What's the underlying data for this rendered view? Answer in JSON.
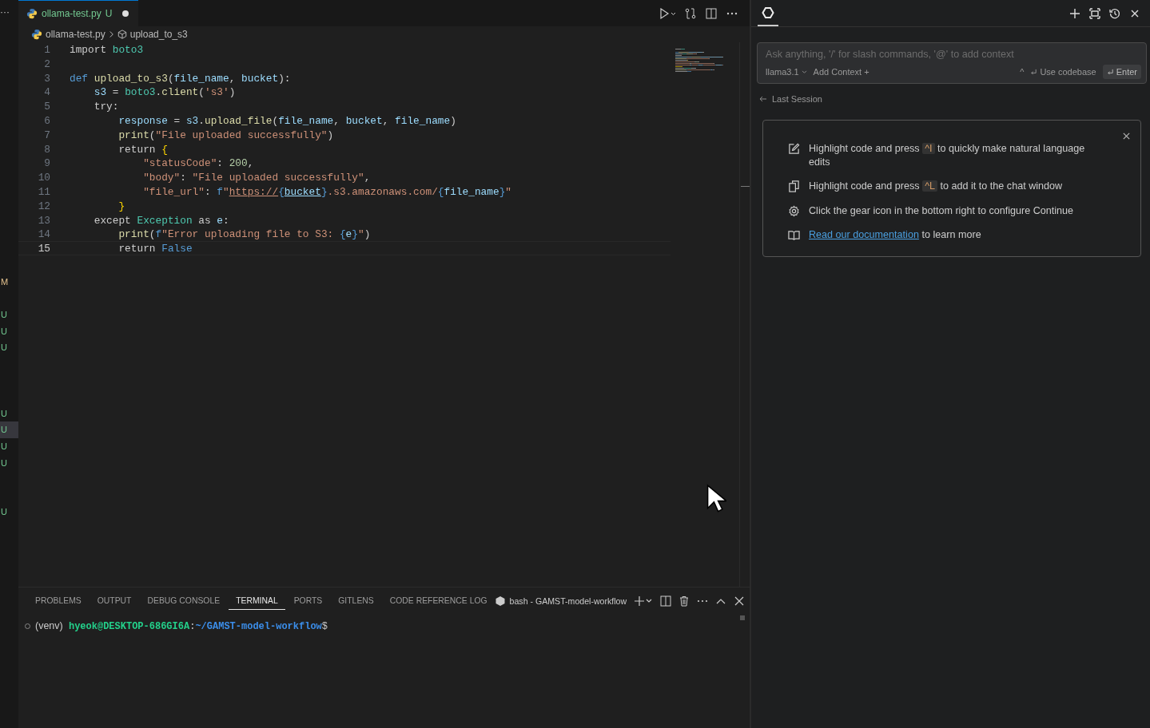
{
  "activity_bar": {
    "overflow": "···",
    "badges": [
      {
        "kind": "badge",
        "letter": "M",
        "color": "#e2c08d",
        "selected": false
      },
      {
        "kind": "spacer"
      },
      {
        "kind": "badge",
        "letter": "U",
        "color": "#73c991",
        "selected": false
      },
      {
        "kind": "badge",
        "letter": "U",
        "color": "#73c991",
        "selected": false
      },
      {
        "kind": "badge",
        "letter": "U",
        "color": "#73c991",
        "selected": false
      },
      {
        "kind": "spacer"
      },
      {
        "kind": "spacer"
      },
      {
        "kind": "spacer"
      },
      {
        "kind": "badge",
        "letter": "U",
        "color": "#73c991",
        "selected": false
      },
      {
        "kind": "badge",
        "letter": "U",
        "color": "#73c991",
        "selected": true
      },
      {
        "kind": "badge",
        "letter": "U",
        "color": "#73c991",
        "selected": false
      },
      {
        "kind": "badge",
        "letter": "U",
        "color": "#73c991",
        "selected": false
      },
      {
        "kind": "spacer"
      },
      {
        "kind": "spacer"
      },
      {
        "kind": "badge",
        "letter": "U",
        "color": "#73c991",
        "selected": false
      }
    ]
  },
  "editor": {
    "tab": {
      "title": "ollama-test.py",
      "status": "U",
      "dirty": true
    },
    "breadcrumb": [
      "ollama-test.py",
      "upload_to_s3"
    ],
    "lines": [
      {
        "number": "1",
        "current": false,
        "tokens": [
          {
            "kind": "plain",
            "text": "import "
          },
          {
            "kind": "module",
            "text": "boto3"
          }
        ]
      },
      {
        "number": "2",
        "current": false
      },
      {
        "number": "3",
        "current": false,
        "tokens": [
          {
            "kind": "keyword",
            "text": "def "
          },
          {
            "kind": "function",
            "text": "upload_to_s3"
          },
          {
            "kind": "plain",
            "text": "("
          },
          {
            "kind": "variable",
            "text": "file_name"
          },
          {
            "kind": "plain",
            "text": ", "
          },
          {
            "kind": "variable",
            "text": "bucket"
          },
          {
            "kind": "plain",
            "text": "):"
          }
        ]
      },
      {
        "number": "4",
        "current": false,
        "tokens": [
          {
            "kind": "variable",
            "text": "    s3"
          },
          {
            "kind": "plain",
            "text": " = "
          },
          {
            "kind": "module",
            "text": "boto3"
          },
          {
            "kind": "plain",
            "text": "."
          },
          {
            "kind": "function",
            "text": "client"
          },
          {
            "kind": "plain",
            "text": "("
          },
          {
            "kind": "string",
            "text": "'s3'"
          },
          {
            "kind": "plain",
            "text": ")"
          }
        ]
      },
      {
        "number": "5",
        "current": false,
        "tokens": [
          {
            "kind": "plain",
            "text": "    try:"
          }
        ]
      },
      {
        "number": "6",
        "current": false,
        "tokens": [
          {
            "kind": "variable",
            "text": "        response"
          },
          {
            "kind": "plain",
            "text": " = "
          },
          {
            "kind": "variable",
            "text": "s3"
          },
          {
            "kind": "plain",
            "text": "."
          },
          {
            "kind": "function",
            "text": "upload_file"
          },
          {
            "kind": "plain",
            "text": "("
          },
          {
            "kind": "variable",
            "text": "file_name"
          },
          {
            "kind": "plain",
            "text": ", "
          },
          {
            "kind": "variable",
            "text": "bucket"
          },
          {
            "kind": "plain",
            "text": ", "
          },
          {
            "kind": "variable",
            "text": "file_name"
          },
          {
            "kind": "plain",
            "text": ")"
          }
        ]
      },
      {
        "number": "7",
        "current": false,
        "tokens": [
          {
            "kind": "function",
            "text": "        print"
          },
          {
            "kind": "plain",
            "text": "("
          },
          {
            "kind": "string",
            "text": "\"File uploaded successfully\""
          },
          {
            "kind": "plain",
            "text": ")"
          }
        ]
      },
      {
        "number": "8",
        "current": false,
        "tokens": [
          {
            "kind": "plain",
            "text": "        return "
          },
          {
            "kind": "brace",
            "text": "{"
          }
        ]
      },
      {
        "number": "9",
        "current": false,
        "tokens": [
          {
            "kind": "string",
            "text": "            \"statusCode\""
          },
          {
            "kind": "plain",
            "text": ": "
          },
          {
            "kind": "number",
            "text": "200"
          },
          {
            "kind": "plain",
            "text": ","
          }
        ]
      },
      {
        "number": "10",
        "current": false,
        "tokens": [
          {
            "kind": "string",
            "text": "            \"body\""
          },
          {
            "kind": "plain",
            "text": ": "
          },
          {
            "kind": "string",
            "text": "\"File uploaded successfully\""
          },
          {
            "kind": "plain",
            "text": ","
          }
        ]
      },
      {
        "number": "11",
        "current": false,
        "tokens": [
          {
            "kind": "string",
            "text": "            \"file_url\""
          },
          {
            "kind": "plain",
            "text": ": "
          },
          {
            "kind": "keyword",
            "text": "f"
          },
          {
            "kind": "string",
            "text": "\""
          },
          {
            "kind": "link",
            "text": "https://"
          },
          {
            "kind": "keyword",
            "text": "{"
          },
          {
            "kind": "link-variable",
            "text": "bucket"
          },
          {
            "kind": "keyword",
            "text": "}"
          },
          {
            "kind": "string",
            "text": ".s3.amazonaws.com/"
          },
          {
            "kind": "keyword",
            "text": "{"
          },
          {
            "kind": "variable",
            "text": "file_name"
          },
          {
            "kind": "keyword",
            "text": "}"
          },
          {
            "kind": "string",
            "text": "\""
          }
        ]
      },
      {
        "number": "12",
        "current": false,
        "tokens": [
          {
            "kind": "brace",
            "text": "        }"
          }
        ]
      },
      {
        "number": "13",
        "current": false,
        "tokens": [
          {
            "kind": "plain",
            "text": "    except "
          },
          {
            "kind": "module",
            "text": "Exception"
          },
          {
            "kind": "plain",
            "text": " as "
          },
          {
            "kind": "variable",
            "text": "e"
          },
          {
            "kind": "plain",
            "text": ":"
          }
        ]
      },
      {
        "number": "14",
        "current": false,
        "tokens": [
          {
            "kind": "function",
            "text": "        print"
          },
          {
            "kind": "plain",
            "text": "("
          },
          {
            "kind": "keyword",
            "text": "f"
          },
          {
            "kind": "string",
            "text": "\"Error uploading file to S3: "
          },
          {
            "kind": "keyword",
            "text": "{"
          },
          {
            "kind": "variable",
            "text": "e"
          },
          {
            "kind": "keyword",
            "text": "}"
          },
          {
            "kind": "string",
            "text": "\""
          },
          {
            "kind": "plain",
            "text": ")"
          }
        ]
      },
      {
        "number": "15",
        "current": true,
        "tokens": [
          {
            "kind": "plain",
            "text": "        return "
          },
          {
            "kind": "keyword",
            "text": "False"
          }
        ]
      }
    ]
  },
  "panel": {
    "tabs": [
      {
        "label": "PROBLEMS",
        "selected": false
      },
      {
        "label": "OUTPUT",
        "selected": false
      },
      {
        "label": "DEBUG CONSOLE",
        "selected": false
      },
      {
        "label": "TERMINAL",
        "selected": true
      },
      {
        "label": "PORTS",
        "selected": false
      },
      {
        "label": "GITLENS",
        "selected": false
      },
      {
        "label": "CODE REFERENCE LOG",
        "selected": false
      }
    ],
    "terminal_name": "bash - GAMST-model-workflow",
    "prompt": {
      "venv": "(venv)",
      "user_host": "hyeok@DESKTOP-686GI6A",
      "separator": ":",
      "path": "~/GAMST-model-workflow",
      "symbol": "$"
    }
  },
  "chat": {
    "input": {
      "placeholder": "Ask anything, '/' for slash commands, '@' to add context",
      "model": "llama3.1",
      "add_context": "Add Context +",
      "shortcut": "^",
      "use_codebase": "Use codebase",
      "enter": "Enter"
    },
    "last_session": "Last Session",
    "tips": [
      {
        "kind": "edit",
        "parts": [
          {
            "kind": "text",
            "text": "Highlight code and press "
          },
          {
            "kind": "key",
            "text": "^I"
          },
          {
            "kind": "text",
            "text": " to quickly make natural language edits"
          }
        ]
      },
      {
        "kind": "copy",
        "parts": [
          {
            "kind": "text",
            "text": "Highlight code and press "
          },
          {
            "kind": "key",
            "text": "^L"
          },
          {
            "kind": "text",
            "text": " to add it to the chat window"
          }
        ]
      },
      {
        "kind": "gear",
        "parts": [
          {
            "kind": "text",
            "text": "Click the gear icon in the bottom right to configure Continue"
          }
        ]
      },
      {
        "kind": "book",
        "parts": [
          {
            "kind": "link",
            "text": "Read our documentation"
          },
          {
            "kind": "text",
            "text": " to learn more"
          }
        ]
      }
    ]
  }
}
